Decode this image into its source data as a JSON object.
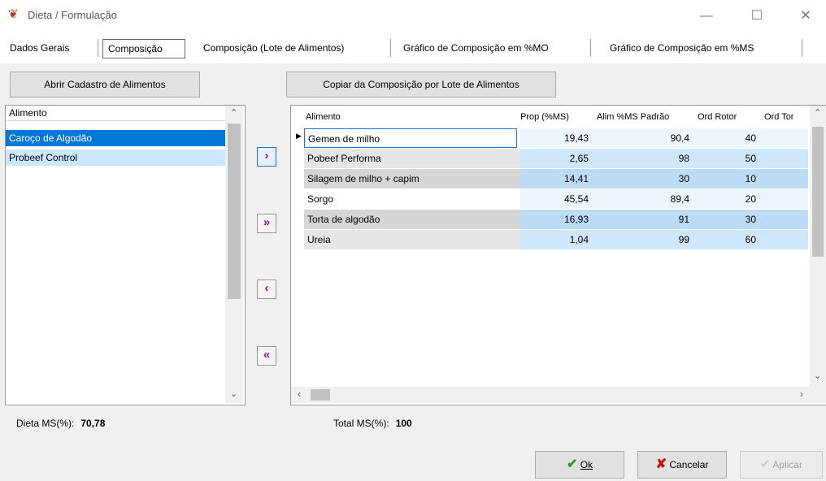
{
  "window": {
    "title": "Dieta / Formulação",
    "minimize": "—",
    "maximize": "☐",
    "close": "✕"
  },
  "tabs": [
    "Dados Gerais",
    "Composição",
    "Composição (Lote de Alimentos)",
    "Gráfico de Composição em %MO",
    "Gráfico de Composição em %MS"
  ],
  "buttons": {
    "open_catalog": "Abrir Cadastro de Alimentos",
    "copy_composition": "Copiar da Composição por Lote de Alimentos",
    "ok": "Ok",
    "cancel": "Cancelar",
    "apply": "Aplicar"
  },
  "list": {
    "header": "Alimento",
    "items": [
      "Caroço de Algodão",
      "Probeef Control"
    ]
  },
  "move": {
    "add_one": "›",
    "add_all": "»",
    "remove_one": "‹",
    "remove_all": "«"
  },
  "grid": {
    "columns": [
      "Alimento",
      "Prop (%MS)",
      "Alim %MS Padrão",
      "Ord Rotor",
      "Ord Tor"
    ],
    "rows": [
      [
        "Gemen de milho",
        "19,43",
        "90,4",
        "40"
      ],
      [
        "Pobeef Performa",
        "2,65",
        "98",
        "50"
      ],
      [
        "Silagem de milho + capim",
        "14,41",
        "30",
        "10"
      ],
      [
        "Sorgo",
        "45,54",
        "89,4",
        "20"
      ],
      [
        "Torta de algodão",
        "16,93",
        "91",
        "30"
      ],
      [
        "Ureia",
        "1,04",
        "99",
        "60"
      ]
    ]
  },
  "stats": {
    "diet_ms_label": "Dieta MS(%):",
    "diet_ms_value": "70,78",
    "total_ms_label": "Total MS(%):",
    "total_ms_value": "100"
  },
  "colors": {
    "selection": "#0078d7",
    "selection_light": "#cce8ff",
    "cell_blue": "#cfe7fb",
    "row_gray": "#e6e6e6",
    "arrow": "#8b1aa0",
    "ok_check": "#2e9b2e",
    "cancel_x": "#d01010"
  }
}
